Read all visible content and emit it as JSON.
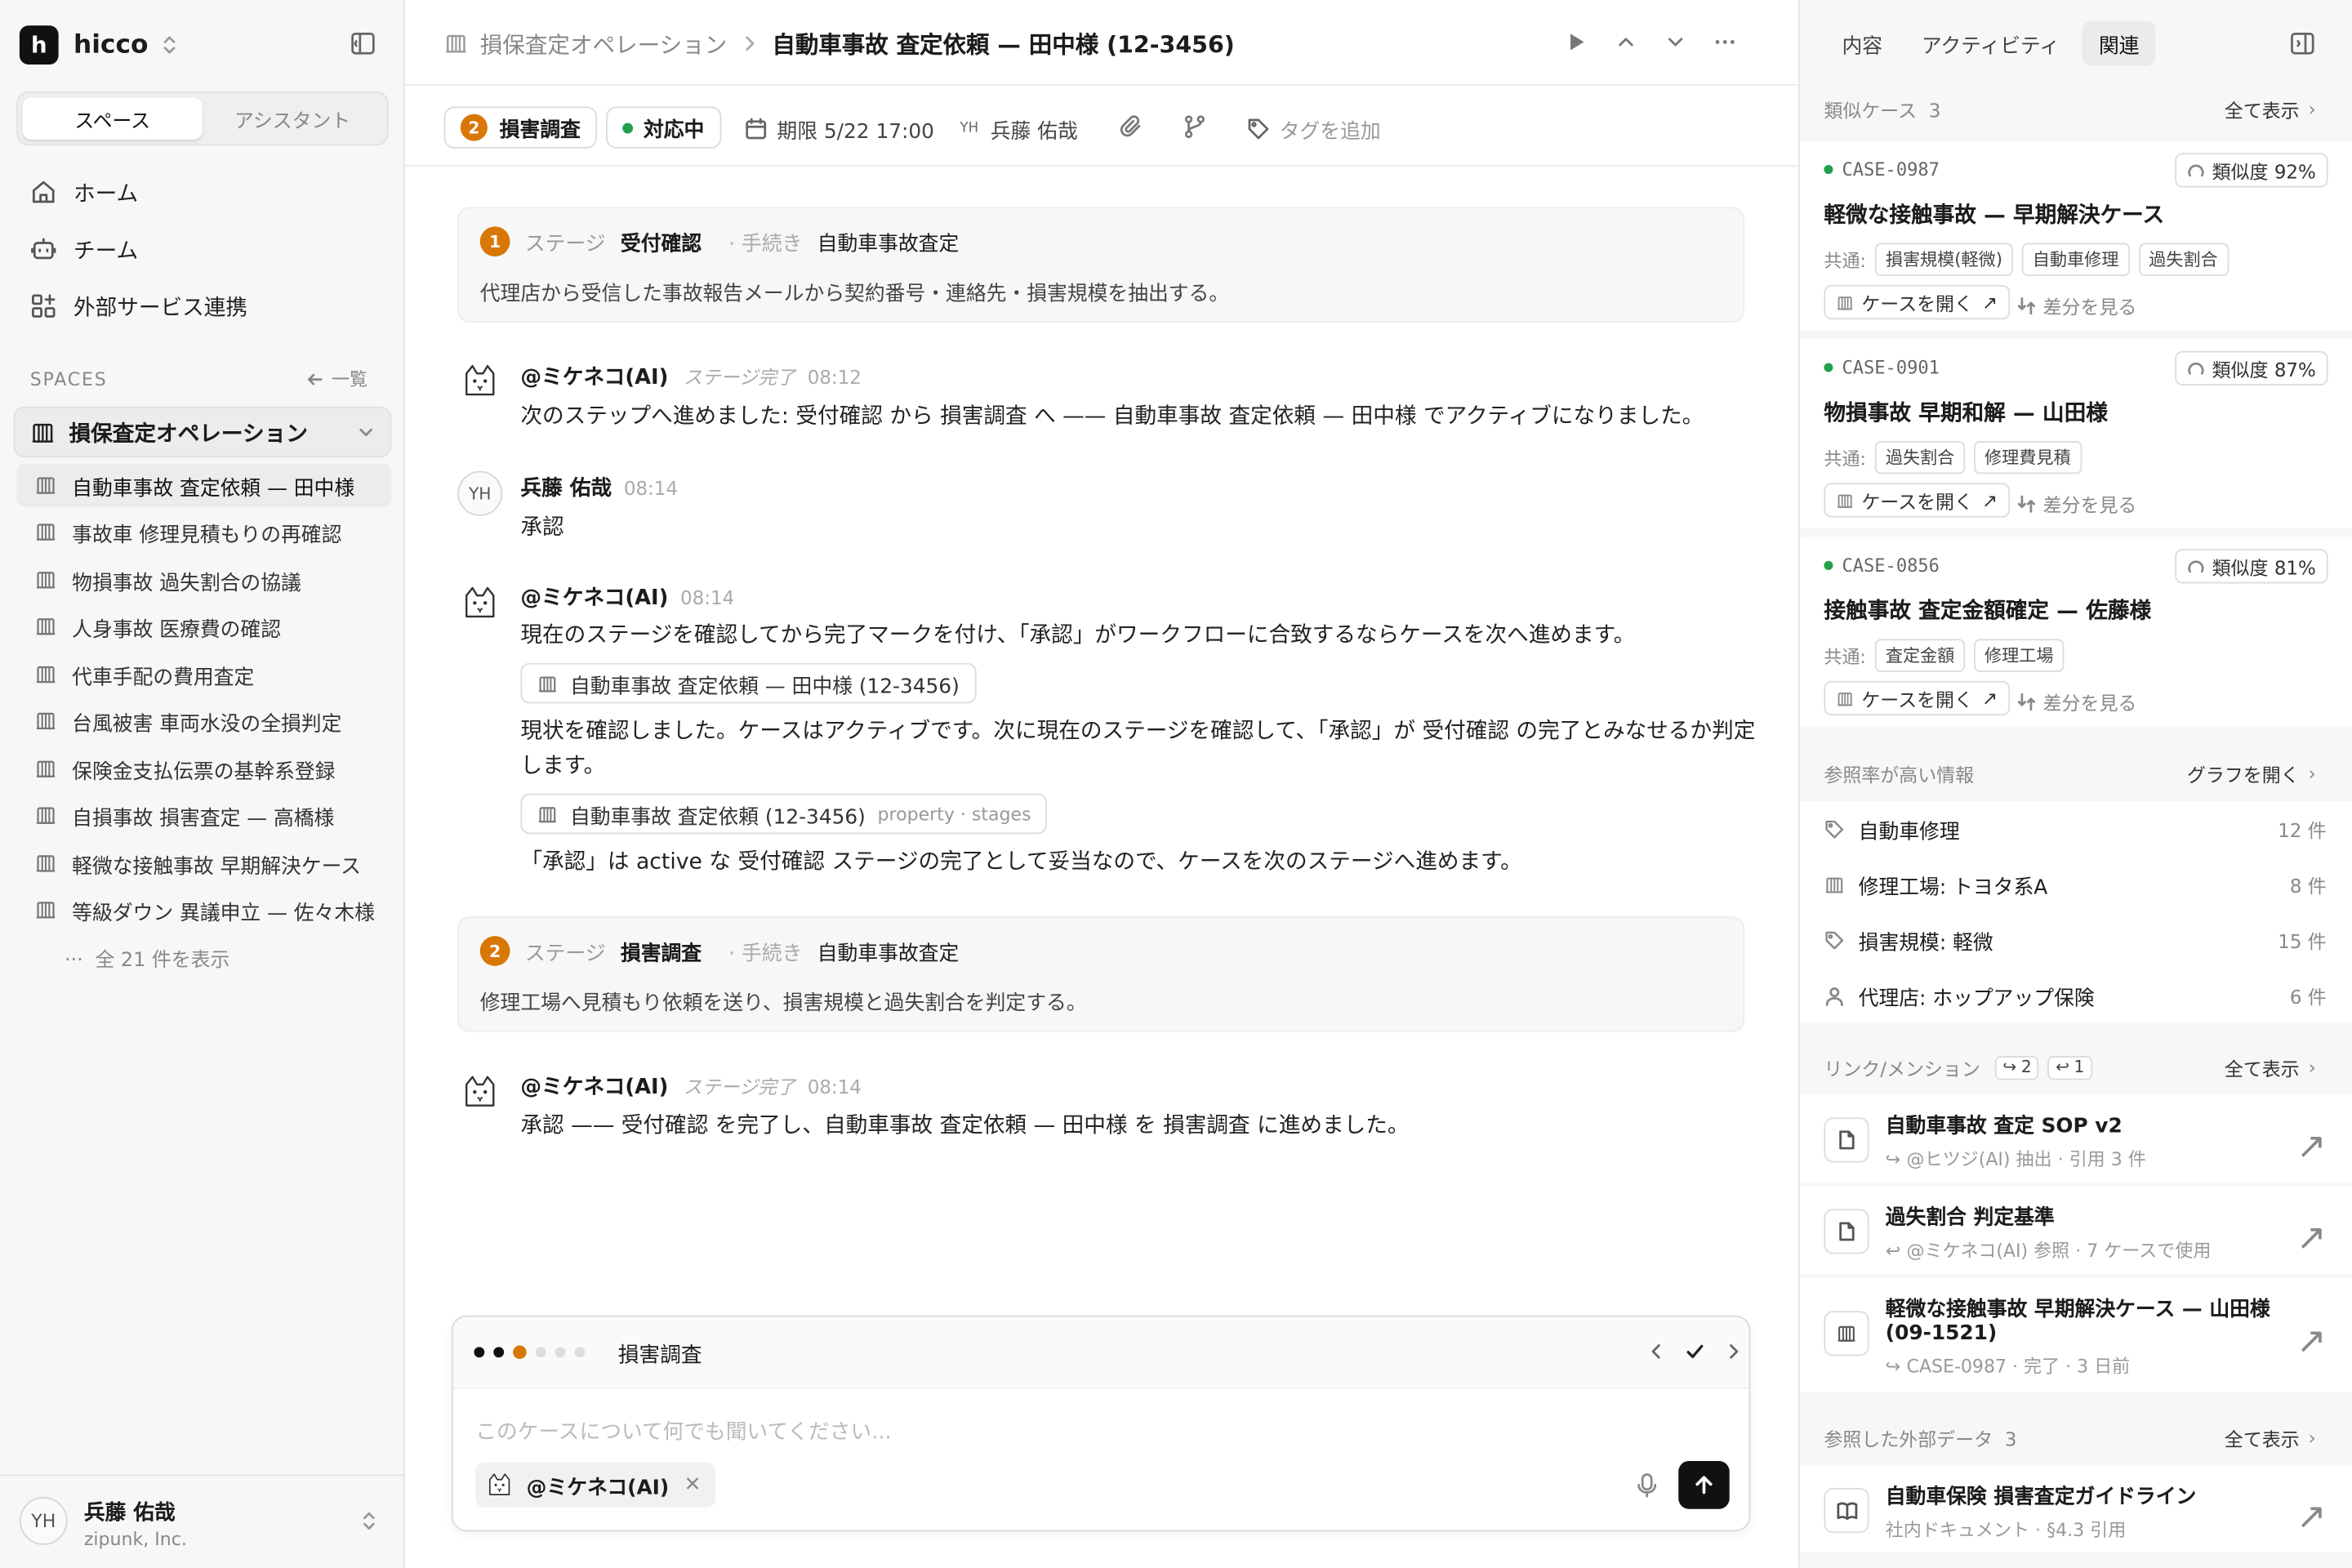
{
  "sidebar": {
    "brand": "hicco",
    "logo_letter": "h",
    "segments": [
      "スペース",
      "アシスタント"
    ],
    "nav": [
      {
        "label": "ホーム",
        "icon": "home-icon"
      },
      {
        "label": "チーム",
        "icon": "team-icon"
      },
      {
        "label": "外部サービス連携",
        "icon": "integrations-icon"
      }
    ],
    "spaces_heading": "SPACES",
    "spaces_back": "一覧",
    "space_name": "損保査定オペレーション",
    "cases": [
      "自動車事故 査定依頼 — 田中様",
      "事故車 修理見積もりの再確認",
      "物損事故 過失割合の協議",
      "人身事故 医療費の確認",
      "代車手配の費用査定",
      "台風被害 車両水没の全損判定",
      "保険金支払伝票の基幹系登録",
      "自損事故 損害査定 — 高橋様",
      "軽微な接触事故 早期解決ケース",
      "等級ダウン 異議申立 — 佐々木様"
    ],
    "show_all": "全 21 件を表示",
    "user": {
      "initials": "YH",
      "name": "兵藤 佑哉",
      "org": "zipunk, Inc."
    }
  },
  "header": {
    "crumb_space": "損保査定オペレーション",
    "crumb_case": "自動車事故 査定依頼 — 田中様 (12-3456)"
  },
  "meta": {
    "stage_num": "2",
    "stage": "損害調査",
    "status": "対応中",
    "status_color": "#22a04b",
    "due": "期限 5/22 17:00",
    "assignee_initials": "YH",
    "assignee": "兵藤 佑哉",
    "add_tag": "タグを追加"
  },
  "timeline": {
    "stage1": {
      "num": "1",
      "label": "ステージ",
      "value": "受付確認",
      "proc_label": "· 手続き",
      "proc": "自動車事故査定",
      "desc": "代理店から受信した事故報告メールから契約番号・連絡先・損害規模を抽出する。"
    },
    "m1": {
      "name": "@ミケネコ(AI)",
      "tag": "ステージ完了",
      "time": "08:12",
      "text": "次のステップへ進めました: 受付確認 から 損害調査 へ —— 自動車事故 査定依頼 — 田中様 でアクティブになりました。"
    },
    "m2": {
      "initials": "YH",
      "name": "兵藤 佑哉",
      "time": "08:14",
      "text": "承認"
    },
    "m3": {
      "name": "@ミケネコ(AI)",
      "time": "08:14",
      "text1": "現在のステージを確認してから完了マークを付け、「承認」がワークフローに合致するならケースを次へ進めます。",
      "chip1": "自動車事故 査定依頼 — 田中様 (12-3456)",
      "text2a": "現状を確認しました。ケースはアクティブです。次に現在のステージを確認して、「承認」が 受付確認 の完了とみなせるか判定",
      "text2b": "します。",
      "chip2": "自動車事故 査定依頼 (12-3456)",
      "chip2_sub": "property · stages",
      "text3": "「承認」は active な 受付確認 ステージの完了として妥当なので、ケースを次のステージへ進めます。"
    },
    "stage2": {
      "num": "2",
      "label": "ステージ",
      "value": "損害調査",
      "proc_label": "· 手続き",
      "proc": "自動車事故査定",
      "desc": "修理工場へ見積もり依頼を送り、損害規模と過失割合を判定する。"
    },
    "m4": {
      "name": "@ミケネコ(AI)",
      "tag": "ステージ完了",
      "time": "08:14",
      "text": "承認 —— 受付確認 を完了し、自動車事故 査定依頼 — 田中様 を 損害調査 に進めました。"
    }
  },
  "composer": {
    "progress": {
      "done": 2,
      "current": 3,
      "total": 7
    },
    "stage": "損害調査",
    "placeholder": "このケースについて何でも聞いてください...",
    "mention": "@ミケネコ(AI)"
  },
  "right": {
    "tabs": [
      "内容",
      "アクティビティ",
      "関連"
    ],
    "similar": {
      "heading": "類似ケース",
      "count": "3",
      "link": "全て表示",
      "common_label": "共通:",
      "open_label": "ケースを開く",
      "diff_label": "差分を見る",
      "items": [
        {
          "id": "CASE-0987",
          "score": "類似度 92%",
          "title": "軽微な接触事故 — 早期解決ケース",
          "tags": [
            "損害規模(軽微)",
            "自動車修理",
            "過失割合"
          ]
        },
        {
          "id": "CASE-0901",
          "score": "類似度 87%",
          "title": "物損事故 早期和解 — 山田様",
          "tags": [
            "過失割合",
            "修理費見積"
          ]
        },
        {
          "id": "CASE-0856",
          "score": "類似度 81%",
          "title": "接触事故 査定金額確定 — 佐藤様",
          "tags": [
            "査定金額",
            "修理工場"
          ]
        }
      ]
    },
    "freq": {
      "heading": "参照率が高い情報",
      "link": "グラフを開く",
      "items": [
        {
          "label": "自動車修理",
          "count": "12 件",
          "icon": "tag-icon"
        },
        {
          "label": "修理工場: トヨタ系A",
          "count": "8 件",
          "icon": "building-icon"
        },
        {
          "label": "損害規模: 軽微",
          "count": "15 件",
          "icon": "tag-icon"
        },
        {
          "label": "代理店: ホップアップ保険",
          "count": "6 件",
          "icon": "person-icon"
        }
      ]
    },
    "links": {
      "heading": "リンク/メンション",
      "out_count": "2",
      "in_count": "1",
      "link": "全て表示",
      "items": [
        {
          "title": "自動車事故 査定 SOP v2",
          "sub": "@ヒツジ(AI) 抽出 · 引用 3 件",
          "icon": "doc-icon"
        },
        {
          "title": "過失割合 判定基準",
          "sub": "@ミケネコ(AI) 参照 · 7 ケースで使用",
          "icon": "doc-icon"
        },
        {
          "title1": "軽微な接触事故 早期解決ケース — 山田様",
          "title2": "(09-1521)",
          "sub": "CASE-0987 · 完了 · 3 日前",
          "icon": "case-icon"
        }
      ]
    },
    "external": {
      "heading": "参照した外部データ",
      "count": "3",
      "link": "全て表示",
      "items": [
        {
          "title": "自動車保険 損害査定ガイドライン",
          "sub": "社内ドキュメント · §4.3 引用",
          "icon": "book-icon"
        }
      ]
    }
  },
  "colors": {
    "accent": "#d97706",
    "status_green": "#22a04b"
  }
}
